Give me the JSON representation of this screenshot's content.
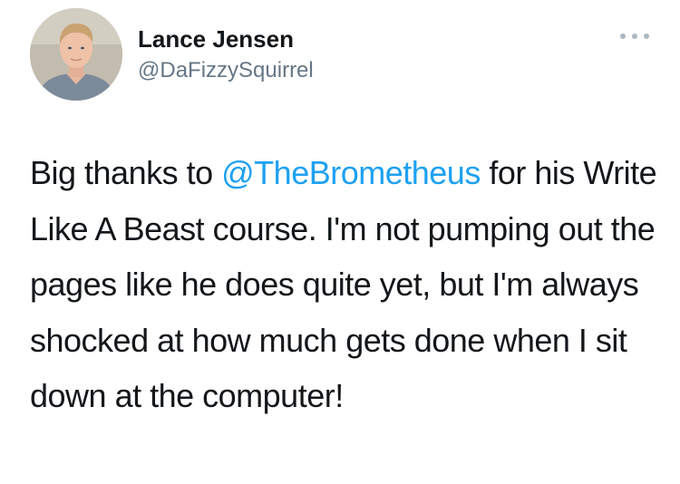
{
  "tweet": {
    "author_name": "Lance Jensen",
    "author_handle": "@DaFizzySquirrel",
    "more_icon": "more-dots-icon",
    "text_before": "Big thanks to ",
    "mention": "@TheBrometheus",
    "text_after": " for his Write Like A Beast course. I'm not pumping out the pages like he does quite yet, but I'm always shocked at how much gets done when I sit down at the computer!"
  },
  "colors": {
    "text": "#14171a",
    "secondary": "#657786",
    "link": "#1da1f2",
    "icon": "#aab8c2"
  }
}
